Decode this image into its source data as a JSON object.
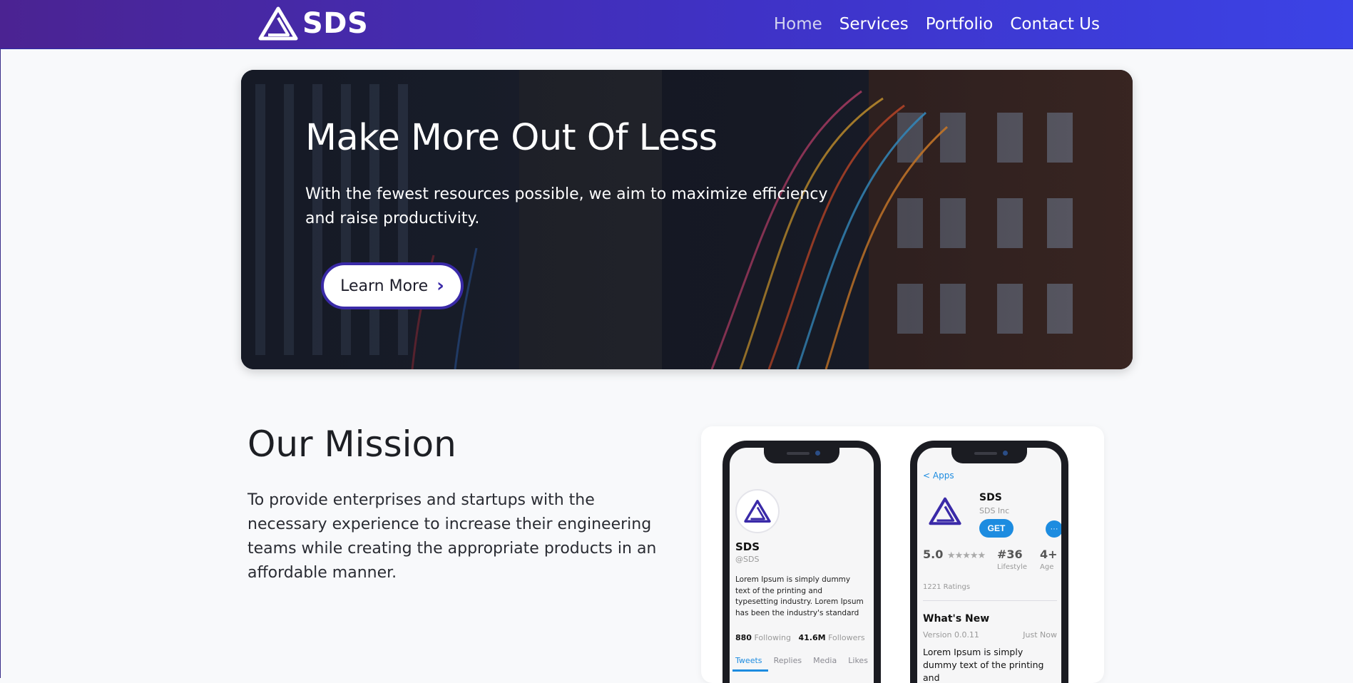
{
  "nav": {
    "brand": "SDS",
    "links": [
      "Home",
      "Services",
      "Portfolio",
      "Contact Us"
    ],
    "active": "Home"
  },
  "hero": {
    "title": "Make More Out Of Less",
    "text": "With the fewest resources possible, we aim to maximize efficiency and raise productivity.",
    "cta": "Learn More"
  },
  "mission": {
    "title": "Our Mission",
    "text": "To provide enterprises and startups with the necessary experience to increase their engineering teams while creating the appropriate products in an affordable manner."
  },
  "phone_profile": {
    "name": "SDS",
    "handle": "@SDS",
    "bio": "Lorem Ipsum is simply dummy text of the printing and typesetting industry. Lorem Ipsum has been the industry's standard",
    "following_count": "880",
    "following_label": "Following",
    "followers_count": "41.6M",
    "followers_label": "Followers",
    "tabs": [
      "Tweets",
      "Replies",
      "Media",
      "Likes"
    ]
  },
  "phone_store": {
    "back": "Apps",
    "name": "SDS",
    "company": "SDS Inc",
    "get": "GET",
    "more": "···",
    "rating": "5.0",
    "stars": "★★★★★",
    "rank": "#36",
    "rank_label": "Lifestyle",
    "age": "4+",
    "age_label": "Age",
    "ratings_count": "1221 Ratings",
    "whats_new": "What's New",
    "version": "Version 0.0.11",
    "when": "Just Now",
    "notes": "Lorem Ipsum is simply dummy text of the printing and"
  },
  "colors": {
    "nav_start": "#4b2392",
    "nav_end": "#3b43e6",
    "accent": "#3a2aa8",
    "link_blue": "#1d8ce0"
  }
}
